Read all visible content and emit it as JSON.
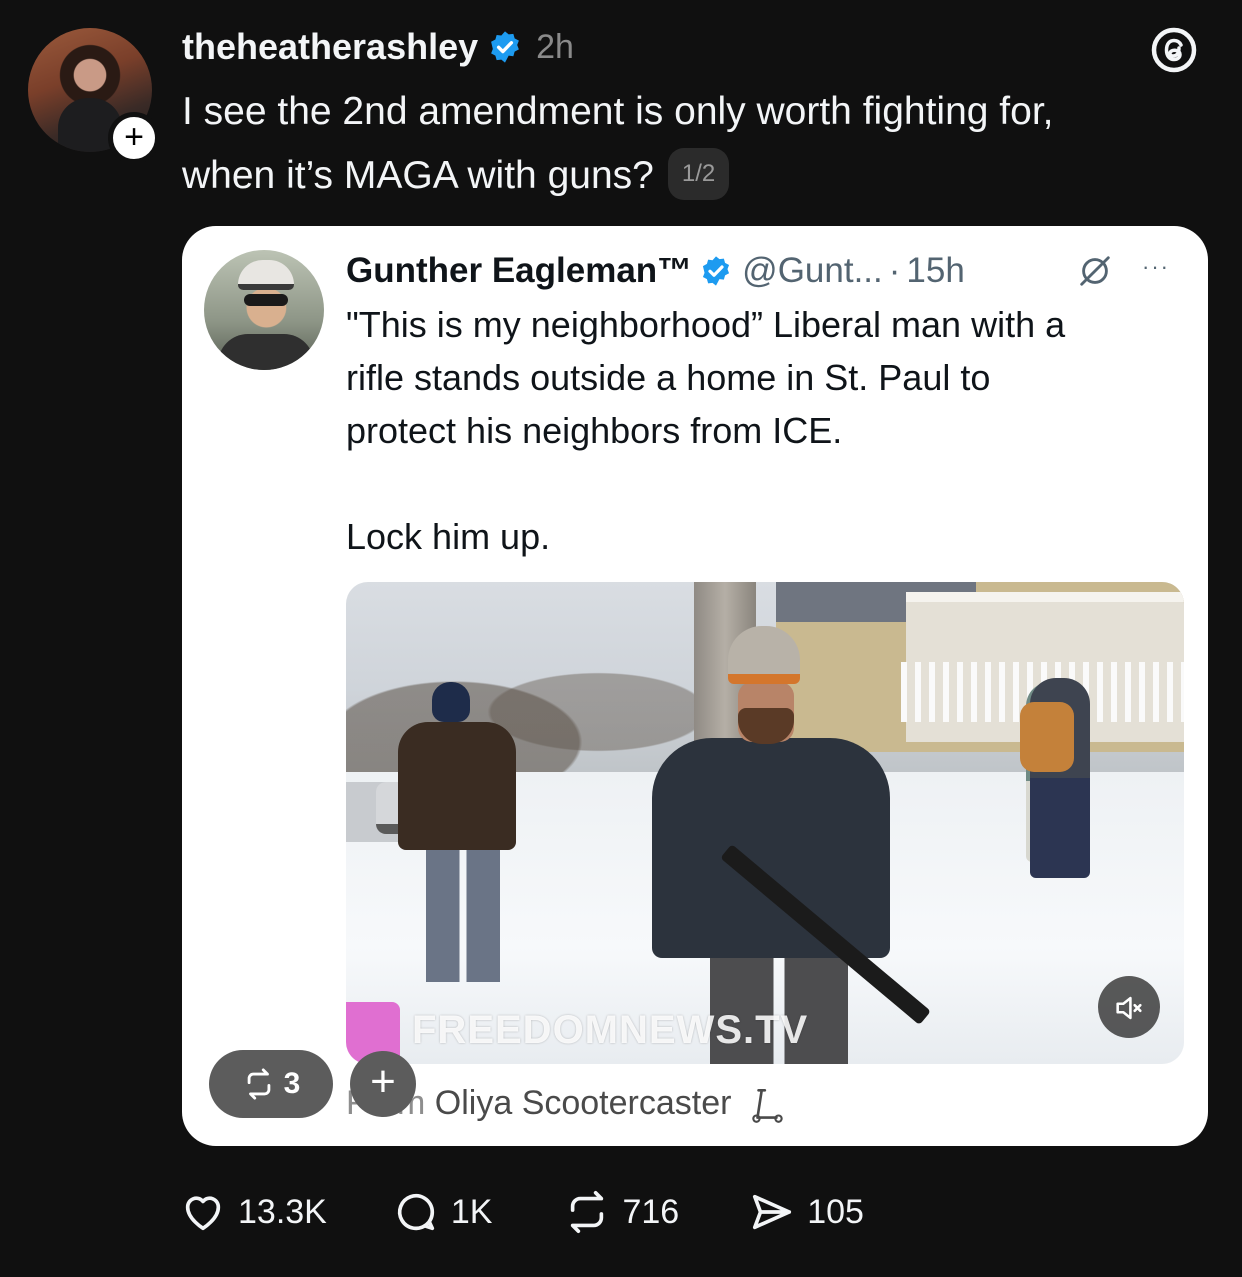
{
  "post": {
    "username": "theheatherashley",
    "timestamp": "2h",
    "text_line1": "I see the 2nd amendment is only worth fighting for,",
    "text_line2": "when it’s MAGA with guns?",
    "page_indicator": "1/2",
    "follow_symbol": "+"
  },
  "quote": {
    "name": "Gunther Eagleman™",
    "handle": "@Gunt...",
    "separator": "·",
    "time": "15h",
    "more": "···",
    "lines": [
      "\"This is my neighborhood” Liberal man with a",
      "rifle stands outside a home in St. Paul to",
      "protect his neighbors from ICE.",
      "Lock him up."
    ],
    "video": {
      "watermark": "FREEDOMNEWS.TV",
      "muted": true
    },
    "repost_count": "3",
    "add_symbol": "+",
    "from_label": "From",
    "from_name": "Oliya Scootercaster"
  },
  "actions": {
    "likes": "13.3K",
    "replies": "1K",
    "reposts": "716",
    "shares": "105"
  },
  "colors": {
    "background": "#101010",
    "verified": "#1d9bf0",
    "watermark_accent": "#e06fd1"
  }
}
